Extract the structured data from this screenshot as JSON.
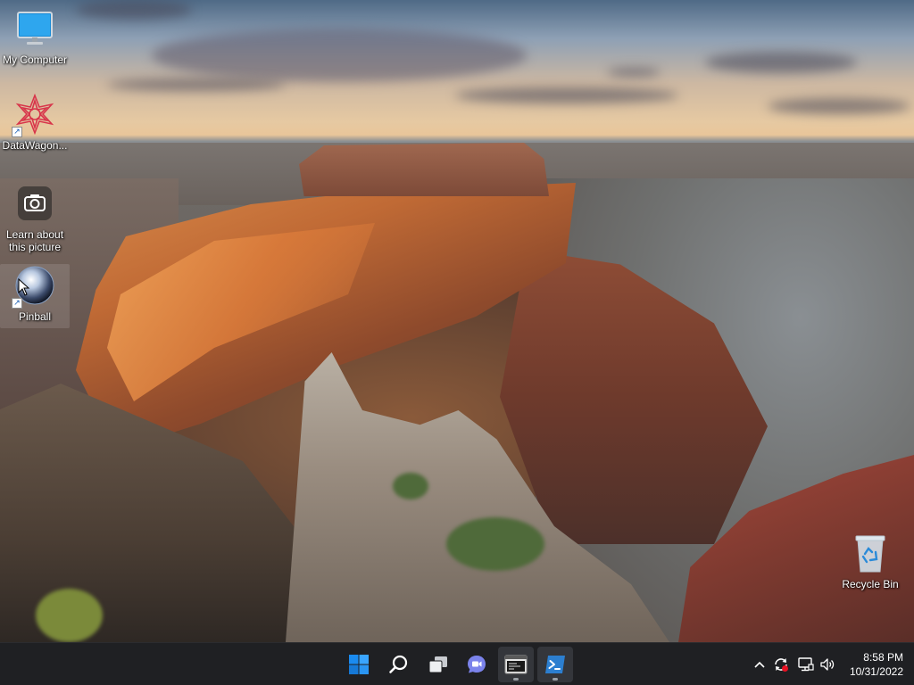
{
  "desktop": {
    "icons": [
      {
        "label": "My Computer",
        "icon": "computer-monitor-icon",
        "shortcut": false
      },
      {
        "label": "DataWagon...",
        "icon": "datawagon-logo-icon",
        "shortcut": true
      },
      {
        "label": "Learn about this picture",
        "icon": "camera-icon",
        "shortcut": false
      },
      {
        "label": "Pinball",
        "icon": "pinball-ball-icon",
        "shortcut": true
      },
      {
        "label": "Recycle Bin",
        "icon": "recycle-bin-icon",
        "shortcut": false
      }
    ]
  },
  "taskbar": {
    "apps": [
      {
        "icon": "windows-start-icon",
        "active": false
      },
      {
        "icon": "search-icon",
        "active": false
      },
      {
        "icon": "task-view-icon",
        "active": false
      },
      {
        "icon": "teams-chat-icon",
        "active": false
      },
      {
        "icon": "terminal-window-icon",
        "active": true
      },
      {
        "icon": "powershell-icon",
        "active": true
      }
    ],
    "tray": {
      "icons": [
        "chevron-up-icon",
        "sync-alert-icon",
        "network-icon",
        "volume-icon"
      ],
      "time": "8:58 PM",
      "date": "10/31/2022"
    },
    "colors": {
      "background": "#1f2023",
      "accent": "#1a8bf0"
    }
  }
}
